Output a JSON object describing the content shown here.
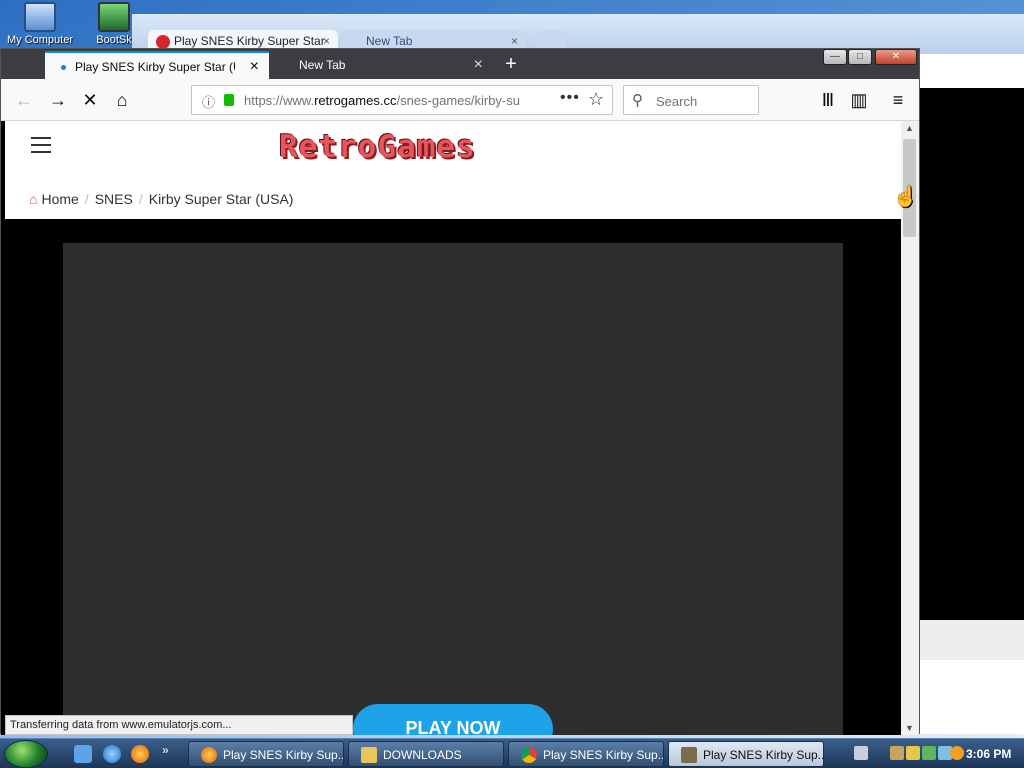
{
  "desktop": {
    "icons": [
      {
        "label": "My Computer"
      },
      {
        "label": "BootSk"
      }
    ]
  },
  "background_window": {
    "tabs": [
      {
        "label": "Play SNES Kirby Super Star"
      },
      {
        "label": "New Tab"
      }
    ],
    "close_glyph": "×"
  },
  "firefox": {
    "tabs": [
      {
        "label": "Play SNES Kirby Super Star (USA)",
        "active": true
      },
      {
        "label": "New Tab",
        "active": false
      }
    ],
    "tab_close_glyph": "×",
    "new_tab_glyph": "+",
    "window_controls": {
      "minimize": "—",
      "maximize": "□",
      "close": "✕"
    },
    "toolbar": {
      "back_glyph": "←",
      "forward_glyph": "→",
      "stop_glyph": "✕",
      "home_glyph": "⌂",
      "library_glyph": "Ⅲ",
      "sidebar_glyph": "▥",
      "menu_glyph": "≡"
    },
    "url": {
      "scheme": "https://www.",
      "host": "retrogames.cc",
      "path": "/snes-games/kirby-su",
      "more_glyph": "•••",
      "bookmark_glyph": "☆",
      "info_glyph": "ⓘ"
    },
    "search": {
      "placeholder": "Search",
      "icon_glyph": "⚲"
    },
    "status_text": "Transferring data from www.emulatorjs.com..."
  },
  "site": {
    "logo": "RetroGames",
    "breadcrumb": [
      {
        "label": "Home",
        "icon": "home-icon"
      },
      {
        "label": "SNES"
      },
      {
        "label": "Kirby Super Star (USA)"
      }
    ],
    "separator": "/",
    "play_button": "PLAY NOW"
  },
  "taskbar": {
    "quicklaunch_more": "»",
    "tasks": [
      {
        "label": "Play SNES Kirby Sup..."
      },
      {
        "label": "DOWNLOADS"
      },
      {
        "label": "Play SNES Kirby Sup..."
      },
      {
        "label": "Play SNES Kirby Sup..."
      }
    ],
    "clock": "3:06 PM"
  },
  "colors": {
    "accent": "#0a84ff",
    "logo": "#e8555b",
    "play_button": "#1fa3e8",
    "secure_lock": "#12bc00"
  }
}
